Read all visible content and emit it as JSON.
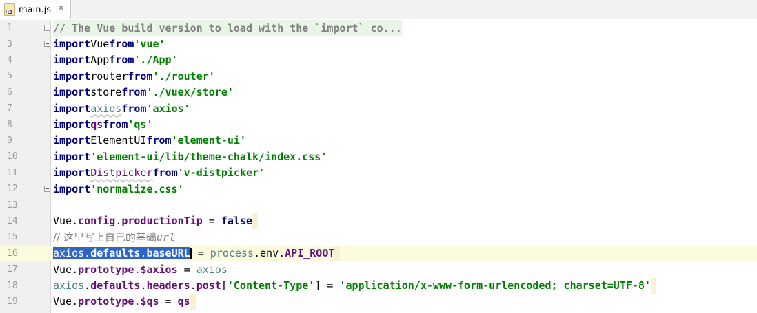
{
  "tab": {
    "label": "main.js",
    "icon": "js-file-icon",
    "badge": "JS",
    "close": "✕"
  },
  "lines": [
    {
      "num": "1",
      "text": "// The Vue build version to load with the `import` co..."
    },
    {
      "num": "3",
      "text": "import Vue from 'vue'"
    },
    {
      "num": "4",
      "text": "import App from './App'"
    },
    {
      "num": "5",
      "text": "import router from './router'"
    },
    {
      "num": "6",
      "text": "import store from './vuex/store'"
    },
    {
      "num": "7",
      "text": "import axios from 'axios'"
    },
    {
      "num": "8",
      "text": "import qs from 'qs'"
    },
    {
      "num": "9",
      "text": "import ElementUI from 'element-ui'"
    },
    {
      "num": "10",
      "text": "import 'element-ui/lib/theme-chalk/index.css'"
    },
    {
      "num": "11",
      "text": "import Distpicker from 'v-distpicker'"
    },
    {
      "num": "12",
      "text": "import 'normalize.css'"
    },
    {
      "num": "13",
      "text": ""
    },
    {
      "num": "14",
      "text": "Vue.config.productionTip = false"
    },
    {
      "num": "15",
      "text": "// 这里写上自己的基础url"
    },
    {
      "num": "16",
      "text": "axios.defaults.baseURL = process.env.API_ROOT"
    },
    {
      "num": "17",
      "text": "Vue.prototype.$axios = axios"
    },
    {
      "num": "18",
      "text": "axios.defaults.headers.post['Content-Type'] = 'application/x-www-form-urlencoded; charset=UTF-8'"
    },
    {
      "num": "19",
      "text": "Vue.prototype.$qs = qs"
    }
  ],
  "tokens": {
    "import": "import",
    "from": "from",
    "false": "false",
    "l1": "// The Vue build version to load with the `import` co...",
    "vue": "Vue",
    "s_vue": "'vue'",
    "app": "App",
    "s_app": "'./App'",
    "router": "router",
    "s_router": "'./router'",
    "store": "store",
    "s_store": "'./vuex/store'",
    "axios": "axios",
    "s_axios": "'axios'",
    "qs": "qs",
    "s_qs": "'qs'",
    "elementui": "ElementUI",
    "s_elementui": "'element-ui'",
    "s_theme": "'element-ui/lib/theme-chalk/index.css'",
    "distpicker": "Distpicker",
    "s_distpicker": "'v-distpicker'",
    "s_normalize": "'normalize.css'",
    "dot": ".",
    "config": "config",
    "productionTip": "productionTip",
    "eq": " = ",
    "c15a": "// 这里写上自己的基础",
    "c15b": "url",
    "defaults": "defaults",
    "baseURL": "baseURL",
    "process": "process",
    "env": "env",
    "api_root": "API_ROOT",
    "prototype": "prototype",
    "p_axios": "$axios",
    "headers": "headers",
    "post": "post",
    "lbr": "[",
    "rbr": "]",
    "s_ct": "'Content-Type'",
    "s_urlenc": "'application/x-www-form-urlencoded; charset=UTF-8'",
    "p_qs": "$qs"
  }
}
